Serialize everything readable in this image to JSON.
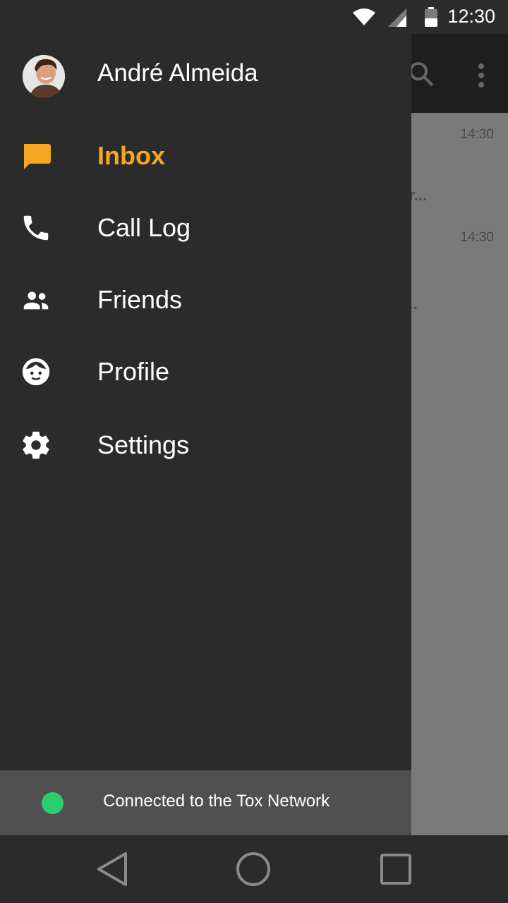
{
  "status_bar": {
    "time": "12:30",
    "icons": [
      "wifi-icon",
      "cell-signal-icon",
      "battery-icon"
    ]
  },
  "background_app": {
    "toolbar_icons": [
      "search-icon",
      "overflow-menu-icon"
    ],
    "conversations": [
      {
        "time": "14:30",
        "preview_fragment": "ur..."
      },
      {
        "time": "14:30",
        "preview_fragment": "r..."
      }
    ]
  },
  "drawer": {
    "user": {
      "name": "André Almeida",
      "avatar": "user-avatar"
    },
    "items": [
      {
        "label": "Inbox",
        "icon": "chat-bubble-icon",
        "active": true
      },
      {
        "label": "Call Log",
        "icon": "phone-icon",
        "active": false
      },
      {
        "label": "Friends",
        "icon": "people-icon",
        "active": false
      },
      {
        "label": "Profile",
        "icon": "face-icon",
        "active": false
      },
      {
        "label": "Settings",
        "icon": "gear-icon",
        "active": false
      }
    ],
    "connection_status": "Connected to the Tox Network"
  },
  "colors": {
    "accent": "#f5a623",
    "drawer_bg": "#2b2b2b",
    "online": "#2ecc71"
  },
  "nav_bar": {
    "buttons": [
      "back-icon",
      "home-icon",
      "recents-icon"
    ]
  }
}
